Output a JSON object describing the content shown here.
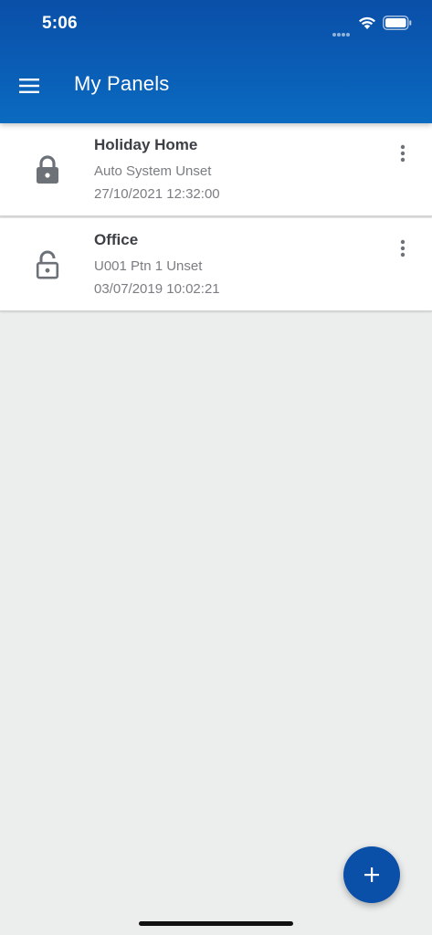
{
  "status_bar": {
    "time": "5:06",
    "icons": [
      "signal-icon",
      "wifi-icon",
      "battery-icon"
    ]
  },
  "header": {
    "menu_icon": "hamburger-menu-icon",
    "title": "My Panels"
  },
  "panels": [
    {
      "name": "Holiday Home",
      "status": "Auto System Unset",
      "timestamp": "27/10/2021 12:32:00",
      "icon": "lock-closed-icon"
    },
    {
      "name": "Office",
      "status": "U001 Ptn 1 Unset",
      "timestamp": "03/07/2019 10:02:21",
      "icon": "lock-open-icon"
    }
  ],
  "fab": {
    "icon": "plus-icon"
  },
  "colors": {
    "header_blue": "#0A5DB5",
    "fab_blue": "#0A4FA8",
    "background": "#ECEDED",
    "icon_grey": "#6D7178",
    "title_text": "#3C3F44",
    "secondary_text": "#7A7D82"
  }
}
